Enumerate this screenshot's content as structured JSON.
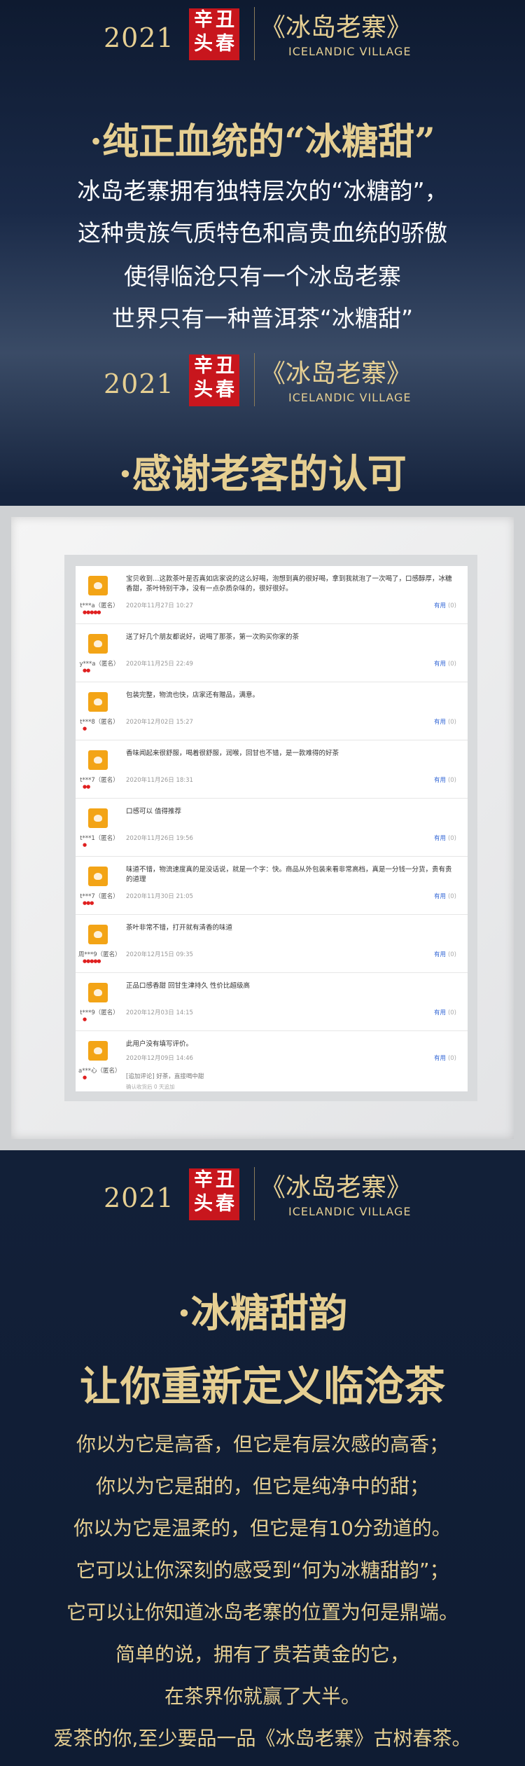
{
  "header": {
    "year": "2021",
    "seal_chars": [
      "辛",
      "丑",
      "头",
      "春"
    ],
    "brand_cn": "《冰岛老寨》",
    "brand_en": "ICELANDIC VILLAGE"
  },
  "section1": {
    "title": "·纯正血统的“冰糖甜”",
    "lines": [
      "冰岛老寨拥有独特层次的“冰糖韵”，",
      "这种贵族气质特色和高贵血统的骄傲",
      "使得临沧只有一个冰岛老寨",
      "世界只有一种普洱茶“冰糖甜”"
    ]
  },
  "section2": {
    "title": "·感谢老客的认可"
  },
  "reviews": [
    {
      "user": "t***a（匿名）",
      "text": "宝贝收到…这款茶叶是否真如店家说的这么好喝，泡想到真的很好喝，拿到我就泡了一次喝了，口感醇厚，冰糖香甜，茶叶特别干净，没有一点杂质杂味的，很好很好。",
      "date": "2020年11月27日 10:27",
      "helpful": "有用",
      "count": "(0)"
    },
    {
      "user": "y***a（匿名）",
      "text": "送了好几个朋友都说好，说喝了那茶，第一次购买你家的茶",
      "date": "2020年11月25日 22:49",
      "helpful": "有用",
      "count": "(0)"
    },
    {
      "user": "t***8（匿名）",
      "text": "包装完整，物流也快，店家还有赠品，满意。",
      "date": "2020年12月02日 15:27",
      "helpful": "有用",
      "count": "(0)"
    },
    {
      "user": "t***7（匿名）",
      "text": "香味闻起来很舒服，喝着很舒服，润喉，回甘也不错，是一款难得的好茶",
      "date": "2020年11月26日 18:31",
      "helpful": "有用",
      "count": "(0)"
    },
    {
      "user": "t***1（匿名）",
      "text": "口感可以 值得推荐",
      "date": "2020年11月26日 19:56",
      "helpful": "有用",
      "count": "(0)"
    },
    {
      "user": "t***7（匿名）",
      "text": "味道不错，物流速度真的是没话说，就是一个字：快。商品从外包装来看非常高档，真是一分钱一分货，贵有贵的道理",
      "date": "2020年11月30日 21:05",
      "helpful": "有用",
      "count": "(0)"
    },
    {
      "user": "周***9（匿名）",
      "text": "茶叶非常不错，打开就有清香的味道",
      "date": "2020年12月15日 09:35",
      "helpful": "有用",
      "count": "(0)"
    },
    {
      "user": "t***9（匿名）",
      "text": "正品口感香甜 回甘生津持久 性价比超级高",
      "date": "2020年12月03日 14:15",
      "helpful": "有用",
      "count": "(0)"
    },
    {
      "user": "a***心（匿名）",
      "text": "此用户没有填写评价。",
      "date": "2020年12月09日 14:46",
      "helpful": "有用",
      "count": "(0)"
    }
  ],
  "review_extra": {
    "followup": "[追加评论] 好茶，直接喝中甜",
    "followup_date": "确认收货后 0 天追加"
  },
  "section3": {
    "title1": "·冰糖甜韵",
    "title2": "让你重新定义临沧茶",
    "lines": [
      "你以为它是高香，但它是有层次感的高香；",
      "你以为它是甜的，但它是纯净中的甜；",
      "你以为它是温柔的，但它是有10分劲道的。",
      "它可以让你深刻的感受到“何为冰糖甜韵”；",
      "它可以让你知道冰岛老寨的位置为何是鼎端。",
      "简单的说，拥有了贵若黄金的它，",
      "在茶界你就赢了大半。",
      "爱茶的你,至少要品一品《冰岛老寨》古树春茶。"
    ]
  }
}
